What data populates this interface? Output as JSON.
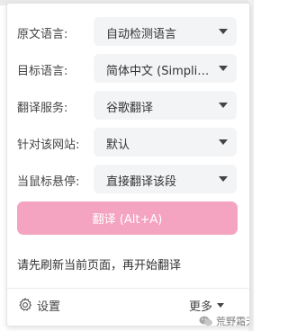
{
  "rows": [
    {
      "label": "原文语言:",
      "value": "自动检测语言"
    },
    {
      "label": "目标语言:",
      "value": "简体中文 (Simplified Chinese)"
    },
    {
      "label": "翻译服务:",
      "value": "谷歌翻译"
    },
    {
      "label": "针对该网站:",
      "value": "默认"
    },
    {
      "label": "当鼠标悬停:",
      "value": "直接翻译该段"
    }
  ],
  "translate_button": "翻译 (Alt+A)",
  "hint": "请先刷新当前页面，再开始翻译",
  "footer": {
    "settings": "设置",
    "more": "更多"
  },
  "watermark": "荒野霜天",
  "colors": {
    "accent_pink": "#f4a4c0",
    "select_bg": "#f3f4f6"
  }
}
